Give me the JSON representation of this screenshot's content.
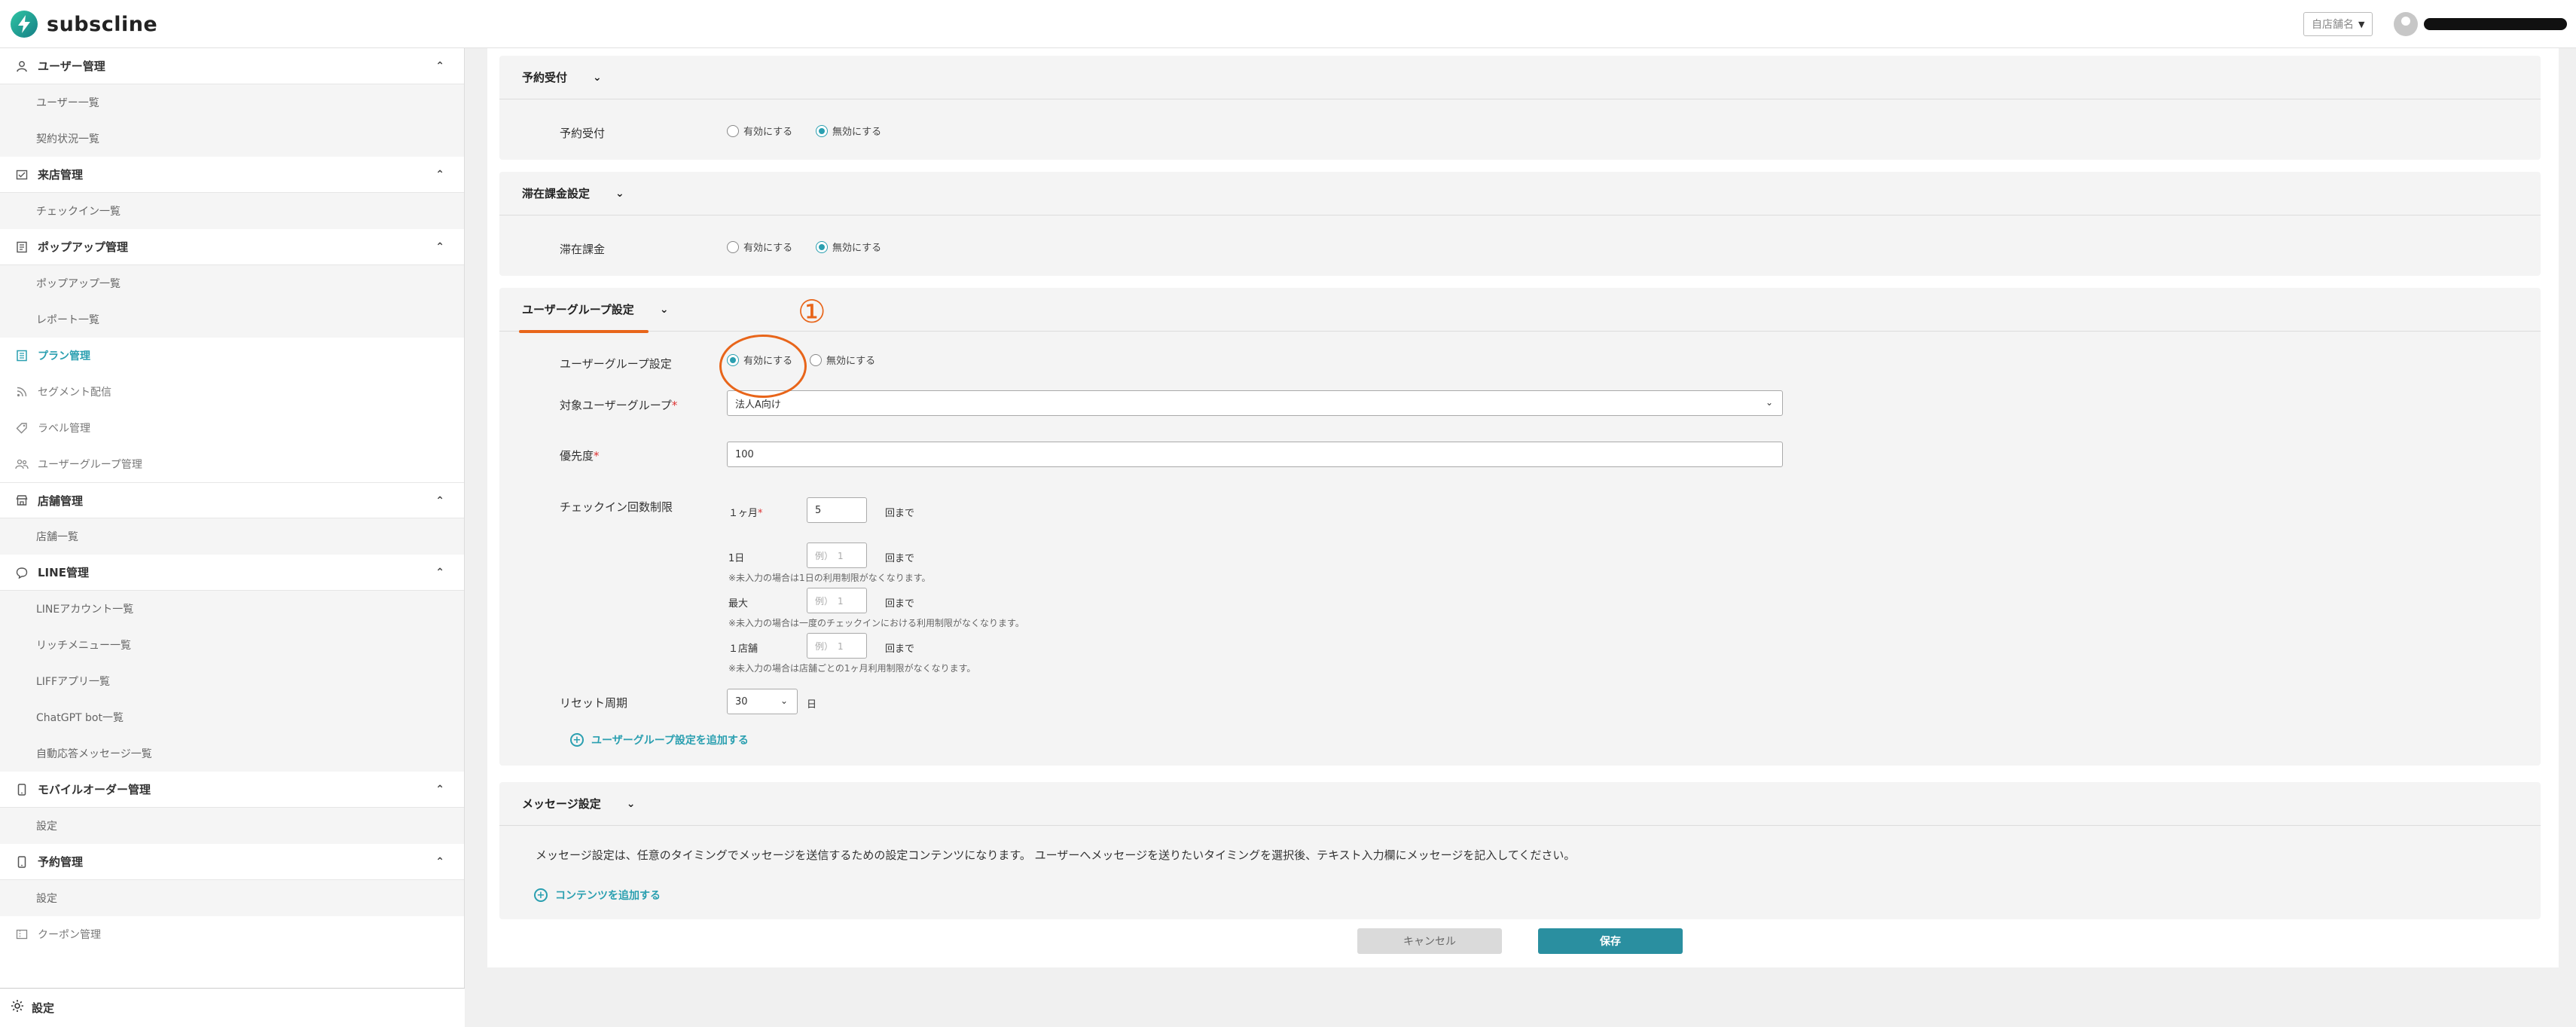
{
  "app": {
    "name": "subscline"
  },
  "header": {
    "store_selector": "自店舗名",
    "user_name": ""
  },
  "sidebar": {
    "sections": [
      {
        "label": "ユーザー管理",
        "items": [
          "ユーザー一覧",
          "契約状況一覧"
        ]
      },
      {
        "label": "来店管理",
        "items": [
          "チェックイン一覧"
        ]
      },
      {
        "label": "ポップアップ管理",
        "items": [
          "ポップアップ一覧",
          "レポート一覧"
        ]
      }
    ],
    "flat_items": [
      "プラン管理",
      "セグメント配信",
      "ラベル管理",
      "ユーザーグループ管理"
    ],
    "sections2": [
      {
        "label": "店舗管理",
        "items": [
          "店舗一覧"
        ]
      },
      {
        "label": "LINE管理",
        "items": [
          "LINEアカウント一覧",
          "リッチメニュー一覧",
          "LIFFアプリ一覧",
          "ChatGPT bot一覧",
          "自動応答メッセージ一覧"
        ]
      },
      {
        "label": "モバイルオーダー管理",
        "items": [
          "設定"
        ]
      },
      {
        "label": "予約管理",
        "items": [
          "設定"
        ]
      }
    ],
    "coupon": "クーポン管理",
    "footer": "設定"
  },
  "reservation": {
    "title": "予約受付",
    "label": "予約受付",
    "enable": "有効にする",
    "disable": "無効にする"
  },
  "stay": {
    "title": "滞在課金設定",
    "label": "滞在課金",
    "enable": "有効にする",
    "disable": "無効にする"
  },
  "user_group": {
    "title": "ユーザーグループ設定",
    "setting_label": "ユーザーグループ設定",
    "enable": "有効にする",
    "disable": "無効にする",
    "target_label": "対象ユーザーグループ",
    "target_value": "法人A向け",
    "priority_label": "優先度",
    "priority_value": "100",
    "checkin_label": "チェックイン回数制限",
    "monthly_label": "１ヶ月",
    "monthly_value": "5",
    "until": "回まで",
    "day_label": "1日",
    "day_placeholder": "例）　1",
    "day_note": "※未入力の場合は1日の利用制限がなくなります。",
    "max_label": "最大",
    "max_placeholder": "例）　1",
    "max_note": "※未入力の場合は一度のチェックインにおける利用制限がなくなります。",
    "store_label": "１店舗",
    "store_placeholder": "例）　1",
    "store_note": "※未入力の場合は店舗ごとの1ヶ月利用制限がなくなります。",
    "reset_label": "リセット周期",
    "reset_value": "30",
    "reset_unit": "日",
    "add_link": "ユーザーグループ設定を追加する"
  },
  "message": {
    "title": "メッセージ設定",
    "description": "メッセージ設定は、任意のタイミングでメッセージを送信するための設定コンテンツになります。 ユーザーへメッセージを送りたいタイミングを選択後、テキスト入力欄にメッセージを記入してください。",
    "add_link": "コンテンツを追加する"
  },
  "actions": {
    "cancel": "キャンセル",
    "save": "保存"
  },
  "annotation": {
    "number": "①"
  },
  "colors": {
    "accent": "#2a9fb0",
    "annotation": "#e8651a"
  }
}
